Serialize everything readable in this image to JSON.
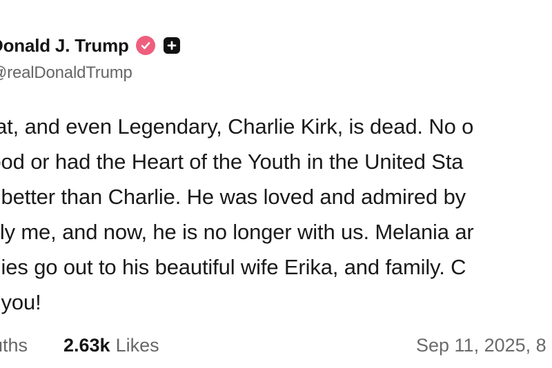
{
  "colors": {
    "verified": "#ee5f7e",
    "text": "#1a1a1a",
    "muted": "#666666",
    "background": "#ffffff"
  },
  "author": {
    "display_name": "Donald J. Trump",
    "handle": "@realDonaldTrump",
    "verified_icon": "verified-badge-icon",
    "extra_icon": "plus-square-icon"
  },
  "post": {
    "lines": [
      "eat, and even Legendary, Charlie Kirk, is dead. No o",
      "tood or had the Heart of the Youth in the United Sta",
      "a better than Charlie. He was loved and admired by",
      "ally me, and now, he is no longer with us. Melania ar",
      "thies go out to his beautiful wife Erika, and family. C",
      "e you!"
    ]
  },
  "stats": {
    "truths_label": "ruths",
    "likes_count": "2.63k",
    "likes_label": "Likes",
    "timestamp": "Sep 11, 2025, 8"
  }
}
